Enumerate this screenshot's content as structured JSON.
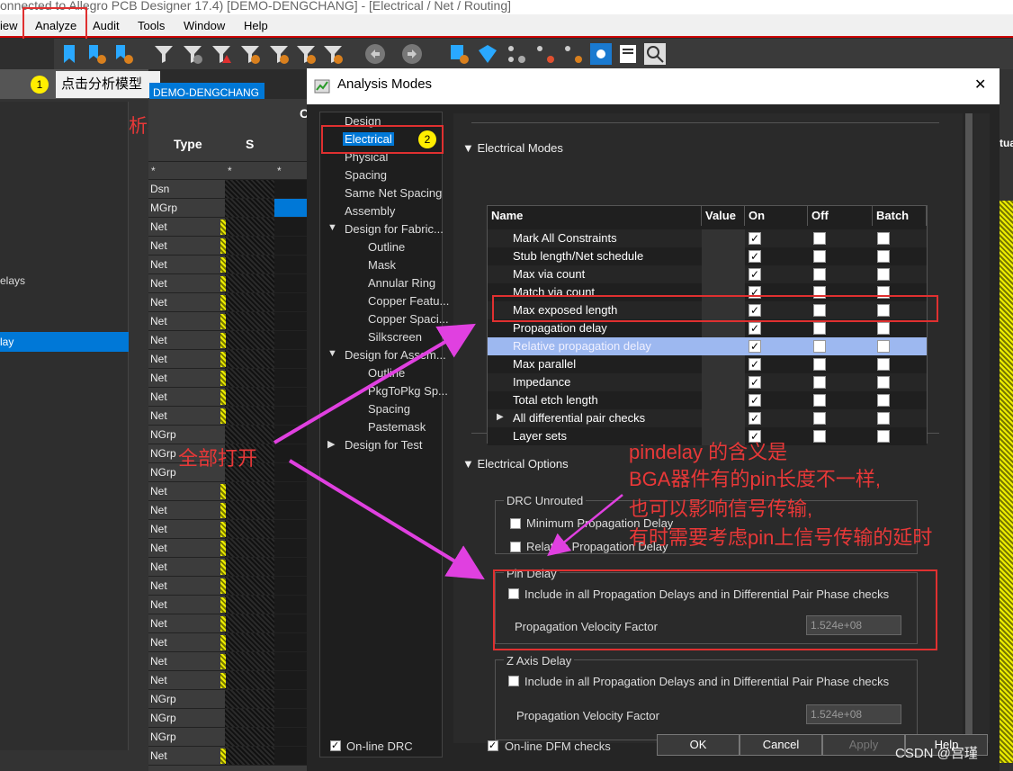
{
  "title_bar": "onnected to Allegro PCB Designer 17.4) [DEMO-DENGCHANG] - [Electrical / Net / Routing]",
  "menu": [
    "iew",
    "Analyze",
    "Audit",
    "Tools",
    "Window",
    "Help"
  ],
  "left": {
    "tooltip_badge": "1",
    "tooltip_text": "点击分析模型",
    "design_tab": "DEMO-DENGCHANG",
    "annotation_click": "点击分析模型",
    "col_type": "Type",
    "col_s": "S",
    "col_c": "C",
    "filter_star": "*",
    "side_text_1": "elays",
    "side_text_2": "lay",
    "rows": [
      "Dsn",
      "MGrp",
      "Net",
      "Net",
      "Net",
      "Net",
      "Net",
      "Net",
      "Net",
      "Net",
      "Net",
      "Net",
      "Net",
      "NGrp",
      "NGrp",
      "NGrp",
      "Net",
      "Net",
      "Net",
      "Net",
      "Net",
      "Net",
      "Net",
      "Net",
      "Net",
      "Net",
      "Net",
      "NGrp",
      "NGrp",
      "NGrp",
      "Net"
    ]
  },
  "dialog": {
    "title": "Analysis Modes",
    "close": "✕",
    "tree": [
      {
        "label": "Design",
        "indent": 0,
        "arrow": ""
      },
      {
        "label": "Electrical",
        "indent": 0,
        "arrow": "",
        "selected": true
      },
      {
        "label": "Physical",
        "indent": 0,
        "arrow": ""
      },
      {
        "label": "Spacing",
        "indent": 0,
        "arrow": ""
      },
      {
        "label": "Same Net Spacing",
        "indent": 0,
        "arrow": ""
      },
      {
        "label": "Assembly",
        "indent": 0,
        "arrow": ""
      },
      {
        "label": "Design for Fabric...",
        "indent": 0,
        "arrow": "▼"
      },
      {
        "label": "Outline",
        "indent": 1,
        "arrow": ""
      },
      {
        "label": "Mask",
        "indent": 1,
        "arrow": ""
      },
      {
        "label": "Annular Ring",
        "indent": 1,
        "arrow": ""
      },
      {
        "label": "Copper Featu...",
        "indent": 1,
        "arrow": ""
      },
      {
        "label": "Copper Spaci...",
        "indent": 1,
        "arrow": ""
      },
      {
        "label": "Silkscreen",
        "indent": 1,
        "arrow": ""
      },
      {
        "label": "Design for Assem...",
        "indent": 0,
        "arrow": "▼"
      },
      {
        "label": "Outline",
        "indent": 1,
        "arrow": ""
      },
      {
        "label": "PkgToPkg Sp...",
        "indent": 1,
        "arrow": ""
      },
      {
        "label": "Spacing",
        "indent": 1,
        "arrow": ""
      },
      {
        "label": "Pastemask",
        "indent": 1,
        "arrow": ""
      },
      {
        "label": "Design for Test",
        "indent": 0,
        "arrow": "▶"
      }
    ],
    "badge2": "2",
    "modes_section": "Electrical Modes",
    "table_headers": [
      "Name",
      "Value",
      "On",
      "Off",
      "Batch"
    ],
    "table_rows": [
      {
        "name": "Mark All Constraints",
        "on": true
      },
      {
        "name": "Stub length/Net schedule",
        "on": true
      },
      {
        "name": "Max via count",
        "on": true
      },
      {
        "name": "Match via count",
        "on": true
      },
      {
        "name": "Max exposed length",
        "on": true
      },
      {
        "name": "Propagation delay",
        "on": true
      },
      {
        "name": "Relative propagation delay",
        "on": true,
        "selected": true
      },
      {
        "name": "Max parallel",
        "on": true
      },
      {
        "name": "Impedance",
        "on": true
      },
      {
        "name": "Total etch length",
        "on": true
      },
      {
        "name": "All differential pair checks",
        "on": true,
        "expand": true
      },
      {
        "name": "Layer sets",
        "on": true
      }
    ],
    "options_section": "Electrical Options",
    "drc_unrouted": "DRC Unrouted",
    "min_prop": "Minimum Propagation Delay",
    "rel_prop": "Relative Propagation Delay",
    "pin_delay": "Pin Delay",
    "include_all": "Include in all Propagation Delays and in Differential Pair Phase checks",
    "pv_factor": "Propagation Velocity Factor",
    "pv_value": "1.524e+08",
    "z_axis": "Z Axis Delay",
    "z_include_all": "Include in all Propagation Delays and in Differential Pair Phase checks",
    "z_pv_factor": "Propagation Velocity Factor",
    "z_pv_value": "1.524e+08",
    "online_drc": "On-line DRC",
    "online_dfm": "On-line DFM checks",
    "ok": "OK",
    "cancel": "Cancel",
    "apply": "Apply",
    "help": "Help"
  },
  "annotations": {
    "all_open": "全部打开",
    "pindelay_1": "pindelay 的含义是",
    "pindelay_2": "BGA器件有的pin长度不一样,",
    "pindelay_3": "也可以影响信号传输,",
    "pindelay_4": "有时需要考虑pin上信号传输的延时",
    "right_edge": "tua"
  },
  "watermark": "CSDN @宫瑾",
  "colors": {
    "accent_red": "#e03030",
    "annotation_red": "#e83838",
    "magenta": "#e040e0",
    "selected_blue": "#0078d7"
  }
}
